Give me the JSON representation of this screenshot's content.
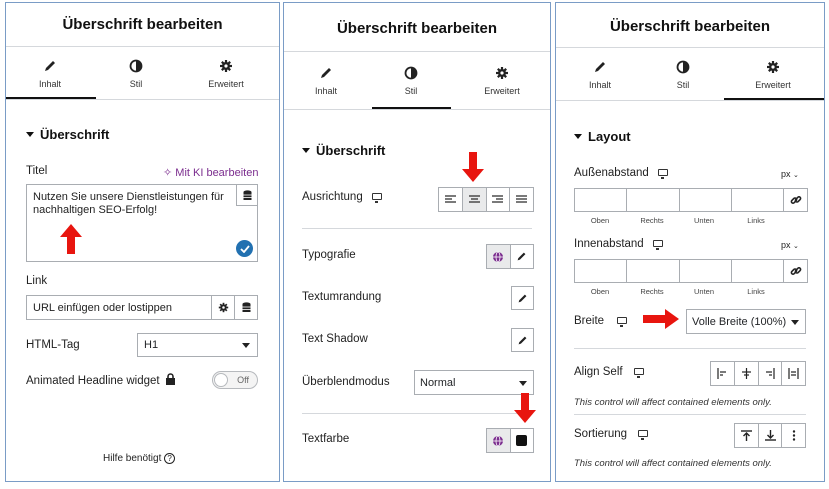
{
  "panel1": {
    "title": "Überschrift bearbeiten",
    "tabs": [
      {
        "label": "Inhalt",
        "icon": "pencil-icon"
      },
      {
        "label": "Stil",
        "icon": "half-circle-icon"
      },
      {
        "label": "Erweitert",
        "icon": "gear-icon"
      }
    ],
    "active_tab": "Inhalt",
    "section": "Überschrift",
    "title_label": "Titel",
    "ai_link": "Mit KI bearbeiten",
    "title_value": "Nutzen Sie unsere Dienstleistungen für nachhaltigen SEO-Erfolg!",
    "link_label": "Link",
    "link_placeholder": "URL einfügen oder lostippen",
    "html_tag_label": "HTML-Tag",
    "html_tag_value": "H1",
    "animated_label": "Animated Headline widget",
    "toggle_text": "Off",
    "help": "Hilfe benötigt"
  },
  "panel2": {
    "title": "Überschrift bearbeiten",
    "tabs": [
      {
        "label": "Inhalt",
        "icon": "pencil-icon"
      },
      {
        "label": "Stil",
        "icon": "half-circle-icon"
      },
      {
        "label": "Erweitert",
        "icon": "gear-icon"
      }
    ],
    "active_tab": "Stil",
    "section": "Überschrift",
    "alignment_label": "Ausrichtung",
    "typography_label": "Typografie",
    "stroke_label": "Textumrandung",
    "shadow_label": "Text Shadow",
    "blend_label": "Überblendmodus",
    "blend_value": "Normal",
    "color_label": "Textfarbe"
  },
  "panel3": {
    "title": "Überschrift bearbeiten",
    "tabs": [
      {
        "label": "Inhalt",
        "icon": "pencil-icon"
      },
      {
        "label": "Stil",
        "icon": "half-circle-icon"
      },
      {
        "label": "Erweitert",
        "icon": "gear-icon"
      }
    ],
    "active_tab": "Erweitert",
    "section": "Layout",
    "margin_label": "Außenabstand",
    "padding_label": "Innenabstand",
    "unit": "px",
    "sides": [
      "Oben",
      "Rechts",
      "Unten",
      "Links"
    ],
    "width_label": "Breite",
    "width_value": "Volle Breite (100%)",
    "align_self_label": "Align Self",
    "align_note": "This control will affect contained elements only.",
    "order_label": "Sortierung",
    "order_note": "This control will affect contained elements only."
  },
  "colors": {
    "accent_purple": "#93003f",
    "ai_purple": "#7b2d8e",
    "check_blue": "#2271b1",
    "red_arrow": "#e8150f"
  }
}
